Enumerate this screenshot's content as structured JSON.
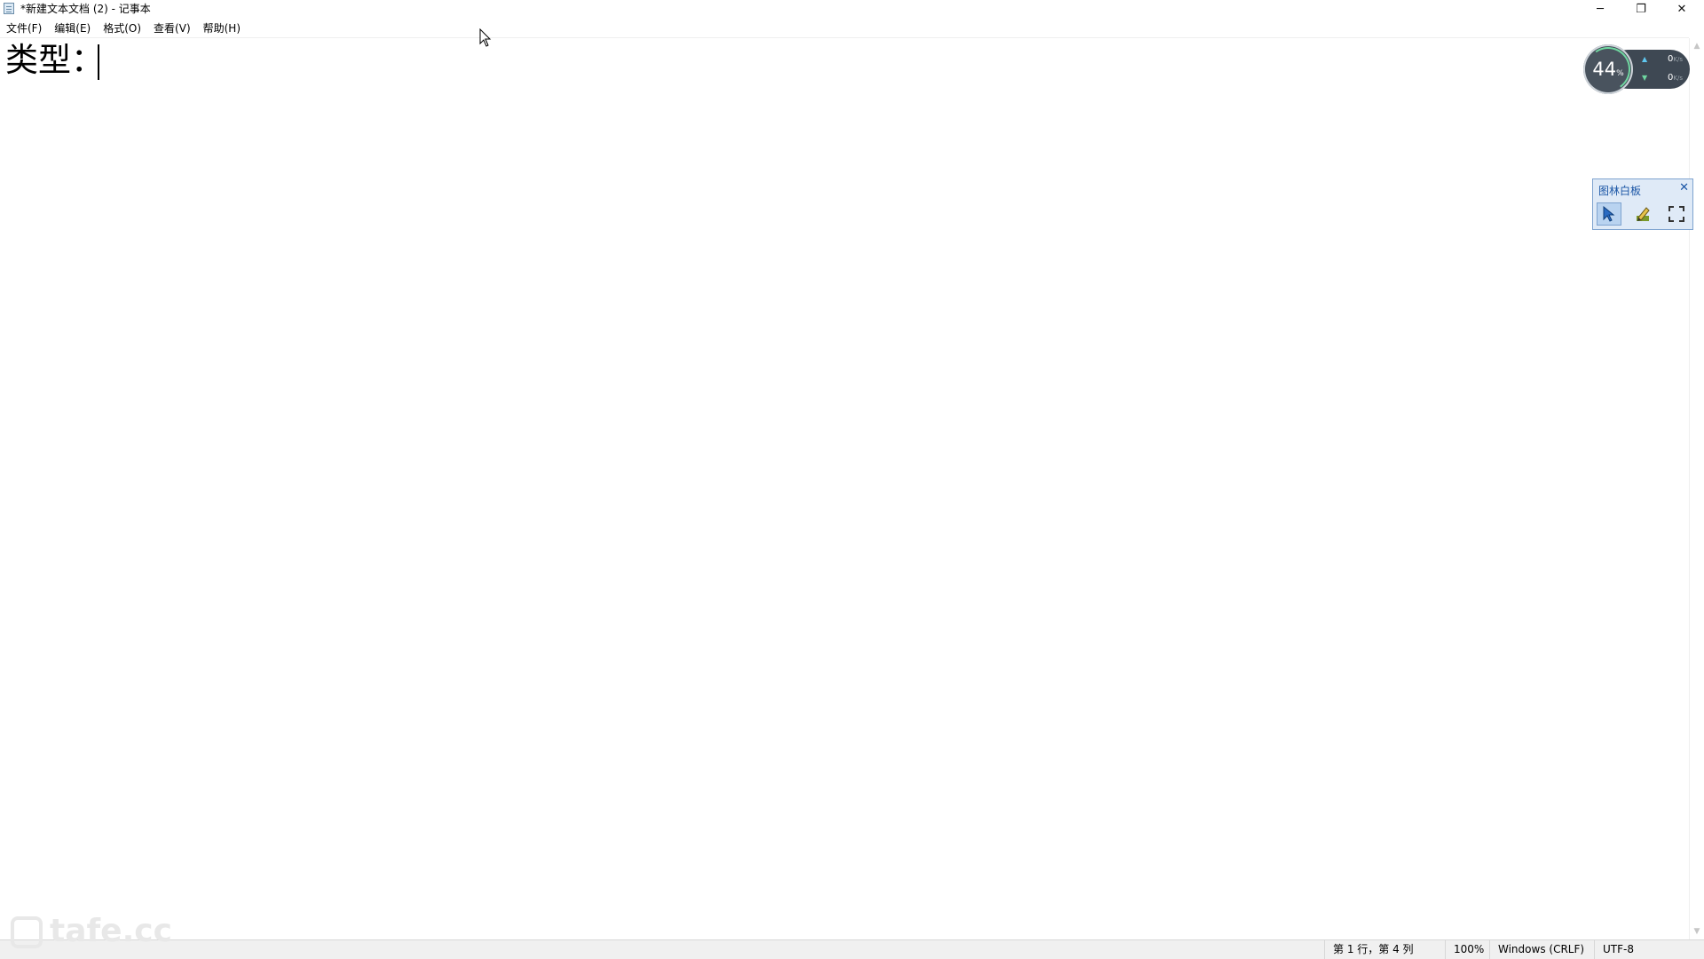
{
  "window": {
    "title": "*新建文本文档 (2) - 记事本",
    "minimize_glyph": "─",
    "restore_glyph": "❐",
    "close_glyph": "✕"
  },
  "menu": {
    "items": [
      "文件(F)",
      "编辑(E)",
      "格式(O)",
      "查看(V)",
      "帮助(H)"
    ]
  },
  "editor": {
    "content": "类型："
  },
  "statusbar": {
    "position": "第 1 行，第 4 列",
    "zoom": "100%",
    "line_ending": "Windows (CRLF)",
    "encoding": "UTF-8"
  },
  "speed_widget": {
    "percent": "44",
    "percent_unit": "%",
    "upload_value": "0",
    "upload_unit": "K/s",
    "download_value": "0",
    "download_unit": "K/s",
    "upload_color": "#5fc7f0",
    "download_color": "#6fd6a0"
  },
  "whiteboard": {
    "title": "图林白板",
    "close_glyph": "✕",
    "tools": [
      "pointer-icon",
      "pen-icon",
      "fullscreen-icon"
    ]
  },
  "watermark": {
    "text": "tafe.cc"
  }
}
